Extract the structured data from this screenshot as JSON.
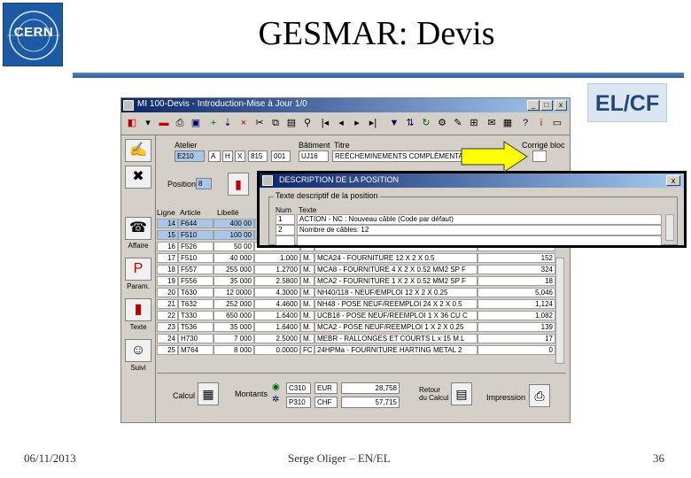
{
  "slide": {
    "logo_text": "CERN",
    "title": "GESMAR: Devis",
    "badge": "EL/CF",
    "footer_date": "06/11/2013",
    "footer_author": "Serge Oliger – EN/EL",
    "footer_page": "36"
  },
  "app": {
    "window_title": "MI 100-Devis - Introduction-Mise à Jour 1/0",
    "fields": {
      "atelier_label": "Atelier",
      "atelier": "E210",
      "atelier_code1": "A",
      "atelier_code2": "H",
      "atelier_code3": "X",
      "atelier_code4": "815",
      "atelier_code5": "001",
      "batiment_label": "Bâtiment",
      "batiment": "UJ16",
      "titre_label": "Titre",
      "titre": "REÉCHEMINEMENTS COMPLÉMENTAIRES",
      "corg_label": "Corrigé bloc",
      "position_label": "Position",
      "position": "8"
    },
    "left_panel": {
      "affaire_label": "Affaire",
      "param_label": "Param.",
      "texte_label": "Texte",
      "suivi_label": "Suivi"
    },
    "table": {
      "headers": [
        "Ligne",
        "Article",
        "Libellé",
        "",
        "",
        "",
        ""
      ],
      "rows": [
        {
          "ligne": "14",
          "article": "F644",
          "qte": "400 00",
          "prix": "",
          "u": "",
          "desc": "",
          "total": "",
          "selected": true
        },
        {
          "ligne": "15",
          "article": "F510",
          "qte": "100 00",
          "prix": "",
          "u": "",
          "desc": "",
          "total": "",
          "selected": true
        },
        {
          "ligne": "16",
          "article": "F526",
          "qte": "50 00",
          "prix": "",
          "u": "",
          "desc": "",
          "total": ""
        },
        {
          "ligne": "17",
          "article": "F510",
          "qte": "40 000",
          "prix": "1.000",
          "u": "M.",
          "desc": "MCA24 - FOURNITURE 12 X 2 X 0.5",
          "total": "152"
        },
        {
          "ligne": "18",
          "article": "F557",
          "qte": "255 000",
          "prix": "1.2700",
          "u": "M.",
          "desc": "MCA8 - FOURNITURE 4 X 2 X 0.52 MM2 SP F",
          "total": "324"
        },
        {
          "ligne": "19",
          "article": "F556",
          "qte": "35 000",
          "prix": "2.5800",
          "u": "M.",
          "desc": "MCA2 - FOURNITURE 1 X 2 X 0.52 MM2 SP F",
          "total": "18"
        },
        {
          "ligne": "20",
          "article": "T630",
          "qte": "12 0000",
          "prix": "4.3000",
          "u": "M.",
          "desc": "NH40/118 - NEUF/EMPLOI 12 X 2 X 0.25",
          "total": "5,046"
        },
        {
          "ligne": "21",
          "article": "T632",
          "qte": "252 000",
          "prix": "4.4600",
          "u": "M.",
          "desc": "NH48 - POSE NEUF/REEMPLOI 24 X 2 X 0.5",
          "total": "1,124"
        },
        {
          "ligne": "22",
          "article": "T330",
          "qte": "650 000",
          "prix": "1.6400",
          "u": "M.",
          "desc": "UCB18 - POSE NEUF/REEMPLOI 1 X 36 CU C",
          "total": "1,082"
        },
        {
          "ligne": "23",
          "article": "T536",
          "qte": "35 000",
          "prix": "1.6400",
          "u": "M.",
          "desc": "MCA2 - POSE NEUF/REEMPLOI 1 X 2 X 0.25",
          "total": "139"
        },
        {
          "ligne": "24",
          "article": "H730",
          "qte": "7 000",
          "prix": "2.5000",
          "u": "M.",
          "desc": "MEBR - RALLONGES ET COURTS L x 15 M.L",
          "total": "17"
        },
        {
          "ligne": "25",
          "article": "M764",
          "qte": "8 000",
          "prix": "0.0000",
          "u": "FC",
          "desc": "24HPMa - FOURNITURE HARTING METAL 2",
          "total": "0"
        }
      ]
    },
    "bottom": {
      "calcul_label": "Calcul",
      "montants_label": "Montants",
      "chf1_code": "C310",
      "chf1_cur": "EUR",
      "chf1_val": "28,758",
      "chf2_code": "P310",
      "chf2_cur": "CHF",
      "chf2_val": "57,715",
      "retour_label": "Retour du Calcul",
      "impression_label": "Impression"
    }
  },
  "dialog": {
    "title": "DESCRIPTION DE LA POSITION",
    "group_label": "Texte descriptif de la position",
    "col_num": "Num",
    "col_texte": "Texte",
    "rows": [
      {
        "num": "1",
        "texte": "ACTION - NC : Nouveau câble (Code par défaut)"
      },
      {
        "num": "2",
        "texte": "Nombre de câbles: 12"
      },
      {
        "num": "",
        "texte": ""
      }
    ]
  },
  "colors": {
    "title_rule": "#2f5d8e",
    "badge_bg": "#dce6f2",
    "badge_text": "#1f497d",
    "arrow": "#ffff00",
    "selected_row": "#a9c5e8",
    "window_titlebar": "#0a246a"
  }
}
